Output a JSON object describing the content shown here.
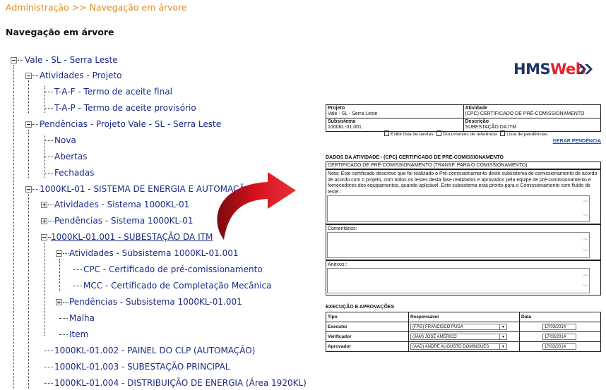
{
  "breadcrumb": "Administração >> Navegação em árvore",
  "page_title": "Navegação em árvore",
  "tree": {
    "root": "Vale - SL - Serra Leste",
    "atividades_projeto": "Atividades - Projeto",
    "taf": "T-A-F - Termo de aceite final",
    "tap": "T-A-P - Termo de aceite provisório",
    "pendencias_projeto": "Pendências - Projeto Vale - SL - Serra Leste",
    "nova": "Nova",
    "abertas": "Abertas",
    "fechadas": "Fechadas",
    "sistema": "1000KL-01 - SISTEMA DE ENERGIA E AUTOMAÇÃO",
    "atividades_sistema": "Atividades - Sistema 1000KL-01",
    "pendencias_sistema": "Pendências - Sistema 1000KL-01",
    "subsistema": "1000KL-01.001 - SUBESTAÇÃO DA ITM",
    "atividades_subsistema": "Atividades - Subsistema 1000KL-01.001",
    "cpc": "CPC - Certificado de pré-comissionamento",
    "mcc": "MCC - Certificado de Completação Mecânica",
    "pendencias_subsistema": "Pendências - Subsistema 1000KL-01.001",
    "malha": "Malha",
    "item": "Item",
    "sub2": "1000KL-01.002 - PAINEL DO CLP (AUTOMAÇÃO)",
    "sub3": "1000KL-01.003 - SUBESTAÇÃO PRINCIPAL",
    "sub4": "1000KL-01.004 - DISTRIBUIÇÃO DE ENERGIA (Área 1920KL)"
  },
  "logo": {
    "part1": "HMS",
    "part2": "Web"
  },
  "doc": {
    "projeto_label": "Projeto",
    "projeto_value": "Vale - SL - Serra Leste",
    "atividade_label": "Atividade",
    "atividade_value": "(CPC) CERTIFICADO DE PRÉ-COMISSIONAMENTO",
    "subsistema_label": "Subsistema",
    "subsistema_value": "1000KL-01.001",
    "descricao_label": "Descrição",
    "descricao_value": "SUBESTAÇÃO DA ITM",
    "link1": "Exibir lista de tarefas",
    "link2": "Documentos de referência",
    "link3": "Lista de pendências",
    "gerar": "GERAR PENDÊNCIA",
    "dados_title": "DADOS DA ATIVIDADE - (CPC) CERTIFICADO DE PRÉ-COMISSIONAMENTO",
    "cert_line": "CERTIFICADO DE PRÉ-COMISSIONAMENTO (TRANSF. PARA O COMISSIONAMENTO)",
    "nota": "Nota: Este certificado descreve que foi realizado o Pré-comissionamento deste subsistema de comissionamento de acordo de acordo com o projeto, com todos os testes desta fase realizados e aprovados pela equipe de pré-comissionamento e fornecedores dos equipamentos, quando aplicável. Este subsistema está pronto para o Comissionamento com fluido de teste.:",
    "comentarios": "Comentários:",
    "anexos": "Anexos::",
    "exec_title": "EXECUÇÃO E APROVAÇÕES",
    "col_tipo": "Tipo",
    "col_resp": "Responsável",
    "col_data": "Data",
    "rows": [
      {
        "tipo": "Executor",
        "resp": "(FPG) FRANCISCO PUGA",
        "data": "17/03/2014"
      },
      {
        "tipo": "Verificador",
        "resp": "(JAM) JOSÉ AMÉRICO",
        "data": "17/03/2014"
      },
      {
        "tipo": "Aprovador",
        "resp": "(AAD) ANDRÉ AUGUSTO DOMINGUES",
        "data": "17/03/2014"
      }
    ]
  },
  "colors": {
    "breadcrumb": "#e08a1e",
    "tree_link": "#1c2a86",
    "logo_dark": "#1e3569",
    "logo_accent": "#e2222a",
    "arrow": "#d6121c"
  }
}
